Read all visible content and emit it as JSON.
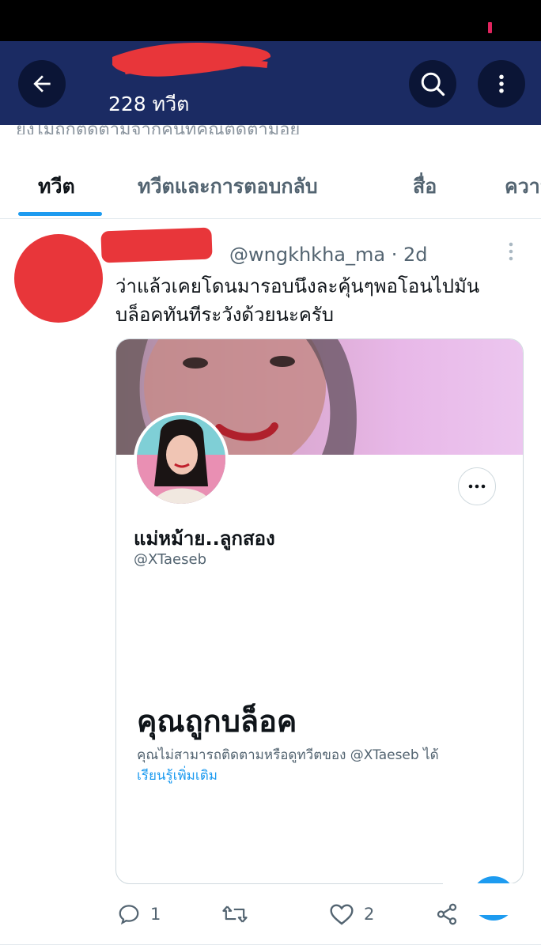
{
  "header": {
    "tweet_count": "228 ทวีต",
    "bio_cut": "ยังไม่ถูกติดตามจากคนที่คุณติดตามอยู่"
  },
  "tabs": [
    {
      "label": "ทวีต",
      "active": true
    },
    {
      "label": "ทวีตและการตอบกลับ"
    },
    {
      "label": "สื่อ"
    },
    {
      "label": "ความ"
    }
  ],
  "tweet": {
    "handle_time": "@wngkhkha_ma · 2d",
    "text": "ว่าแล้วเคยโดนมารอบนึงละคุ้นๆพอโอนไปมัน บล็อคทันทีระวังด้วยนะครับ",
    "card": {
      "name": "แม่หม้าย..ลูกสอง",
      "handle": "@XTaeseb",
      "blocked_title": "คุณถูกบล็อค",
      "blocked_desc": "คุณไม่สามารถติดตามหรือดูทวีตของ @XTaeseb ได้",
      "learn_more": "เรียนรู้เพิ่มเติม"
    },
    "actions": {
      "replies": "1",
      "retweets": "",
      "likes": "2"
    }
  },
  "icons": {
    "back": "back-arrow-icon",
    "search": "search-icon",
    "more": "more-vertical-icon",
    "reply": "reply-icon",
    "retweet": "retweet-icon",
    "like": "heart-icon",
    "share": "share-icon"
  },
  "colors": {
    "header_bg": "#1b2b63",
    "accent": "#1d9bf0",
    "redaction": "#e8363a"
  }
}
